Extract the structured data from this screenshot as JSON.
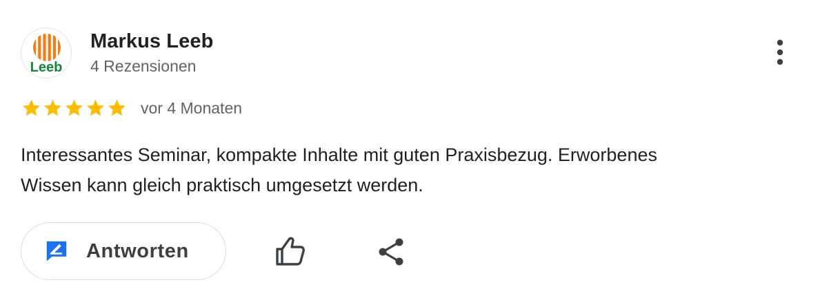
{
  "reviewer": {
    "name": "Markus Leeb",
    "review_count": "4 Rezensionen",
    "avatar_logo_text": "Leeb",
    "avatar_icon": "leeb-logo-icon"
  },
  "rating": {
    "stars": 5,
    "max_stars": 5,
    "star_color": "#fbbc04",
    "star_icon": "star-icon",
    "date": "vor 4 Monaten"
  },
  "review": {
    "text": "Interessantes Seminar, kompakte Inhalte mit guten Praxisbezug. Erworbenes\nWissen kann gleich praktisch umgesetzt werden."
  },
  "actions": {
    "reply_label": "Antworten",
    "reply_icon": "reply-icon",
    "like_icon": "thumb-up-icon",
    "share_icon": "share-icon",
    "more_icon": "more-vert-icon",
    "accent_color": "#1a73e8"
  },
  "colors": {
    "logo_orange": "#f07d17",
    "logo_green": "#13853c"
  }
}
